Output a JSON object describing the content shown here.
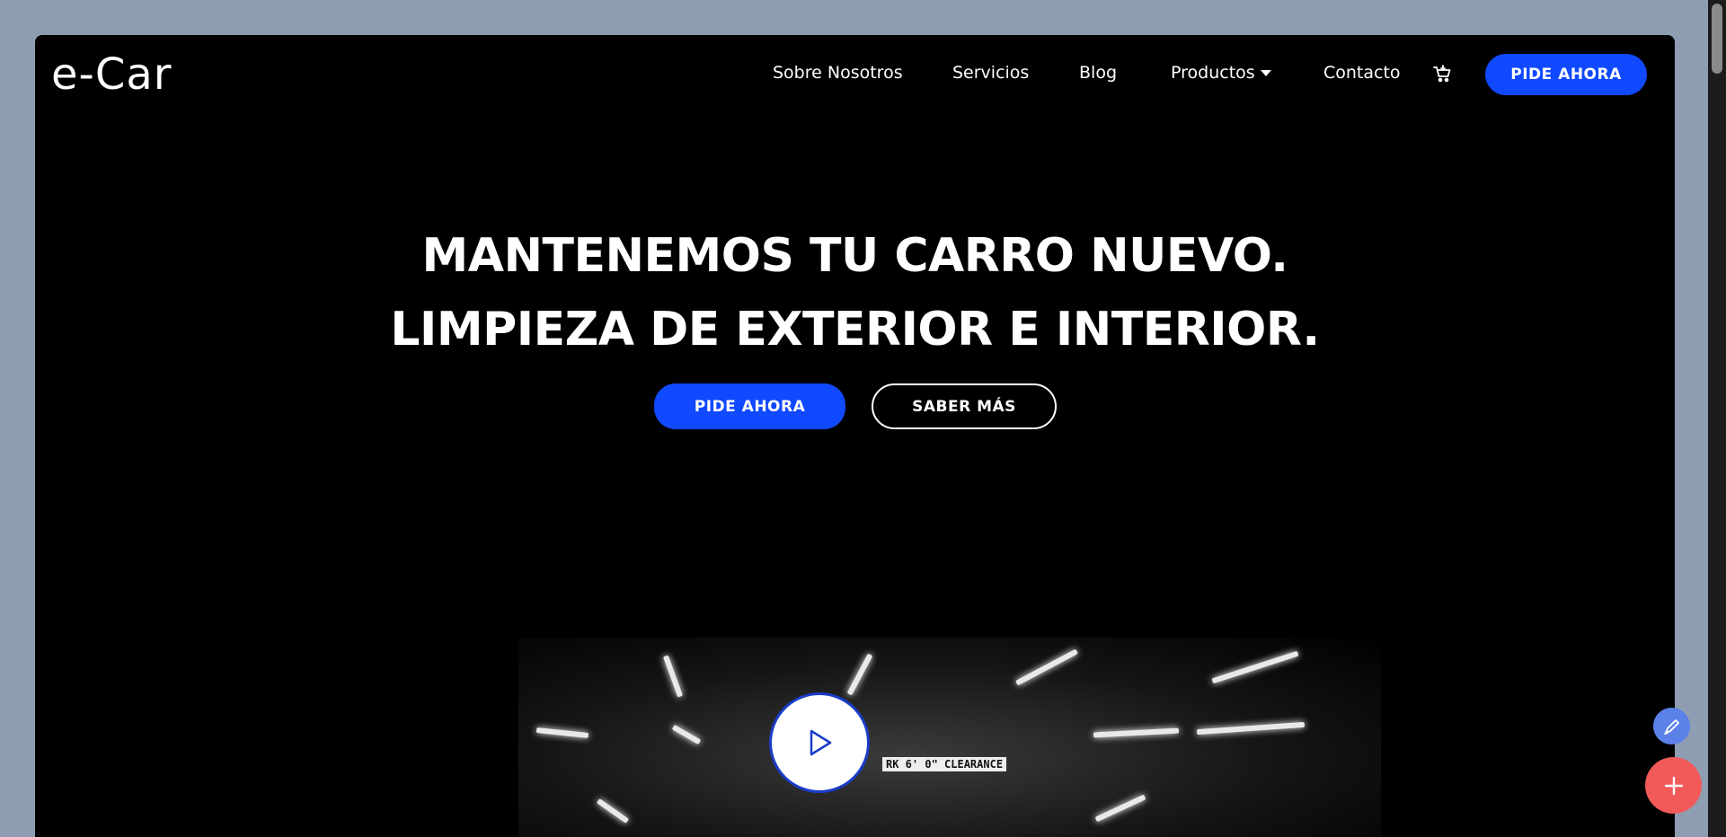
{
  "brand": {
    "logo_text": "e-Car"
  },
  "nav": {
    "items": [
      {
        "label": "Sobre Nosotros"
      },
      {
        "label": "Servicios"
      },
      {
        "label": "Blog"
      },
      {
        "label": "Productos"
      },
      {
        "label": "Contacto"
      }
    ],
    "cta_label": "PIDE AHORA",
    "cart_icon": "cart-icon"
  },
  "hero": {
    "line1": "MANTENEMOS TU CARRO NUEVO.",
    "line2": "LIMPIEZA DE EXTERIOR E INTERIOR.",
    "primary_label": "PIDE AHORA",
    "secondary_label": "SABER MÁS"
  },
  "video": {
    "sign_text": "RK 6' 0\" CLEARANCE",
    "play_icon": "play-icon"
  },
  "colors": {
    "accent": "#1049ff",
    "background": "#000000",
    "page_bg": "#8f9db3",
    "fab_add": "#f25a5a",
    "fab_edit": "#5b82e8"
  }
}
